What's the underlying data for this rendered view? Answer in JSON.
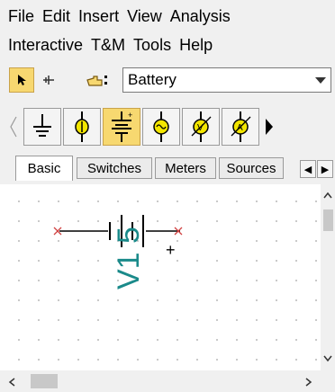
{
  "menu": {
    "row1": [
      "File",
      "Edit",
      "Insert",
      "View",
      "Analysis"
    ],
    "row2": [
      "Interactive",
      "T&M",
      "Tools",
      "Help"
    ]
  },
  "toolbar": {
    "component_select": {
      "value": "Battery"
    }
  },
  "palette": {
    "items": [
      {
        "icon": "ground-icon",
        "selected": false
      },
      {
        "icon": "current-source-icon",
        "selected": false
      },
      {
        "icon": "battery-icon",
        "selected": true
      },
      {
        "icon": "ammeter-icon",
        "selected": false
      },
      {
        "icon": "voltmeter-icon",
        "selected": false
      },
      {
        "icon": "ammeter-arrow-icon",
        "selected": false
      }
    ]
  },
  "tabs": [
    "Basic",
    "Switches",
    "Meters",
    "Sources"
  ],
  "canvas": {
    "component_label": "V1 5",
    "polarity": "+"
  },
  "colors": {
    "selected_bg": "#f7d870",
    "component_label": "#1a8a8a",
    "node_marker": "#d04040"
  }
}
